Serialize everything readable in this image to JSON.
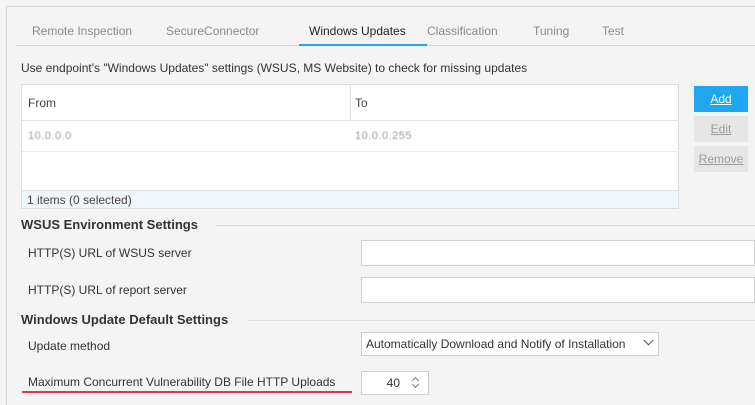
{
  "tabs": [
    {
      "label": "Remote Inspection"
    },
    {
      "label": "SecureConnector"
    },
    {
      "label": "Windows Updates"
    },
    {
      "label": "Classification"
    },
    {
      "label": "Tuning"
    },
    {
      "label": "Test"
    }
  ],
  "active_tab": "Windows Updates",
  "description": "Use endpoint's \"Windows Updates\" settings (WSUS, MS Website) to check for missing updates",
  "table": {
    "columns": [
      "From",
      "To"
    ],
    "rows": [
      {
        "from": "10.0.0.0",
        "to": "10.0.0.255"
      }
    ],
    "footer": "1 items (0 selected)"
  },
  "buttons": {
    "add": "Add",
    "edit": "Edit",
    "remove": "Remove"
  },
  "wsus": {
    "section_title": "WSUS Environment Settings",
    "wsus_server_label": "HTTP(S) URL of WSUS server",
    "wsus_server_value": "",
    "report_server_label": "HTTP(S) URL of report server",
    "report_server_value": ""
  },
  "defaults": {
    "section_title": "Windows Update Default Settings",
    "update_method_label": "Update method",
    "update_method_value": "Automatically Download and Notify of Installation",
    "max_uploads_label": "Maximum Concurrent Vulnerability DB File HTTP Uploads",
    "max_uploads_value": "40"
  },
  "colors": {
    "accent": "#1ea7f0",
    "highlight_underline": "#e8324e"
  }
}
